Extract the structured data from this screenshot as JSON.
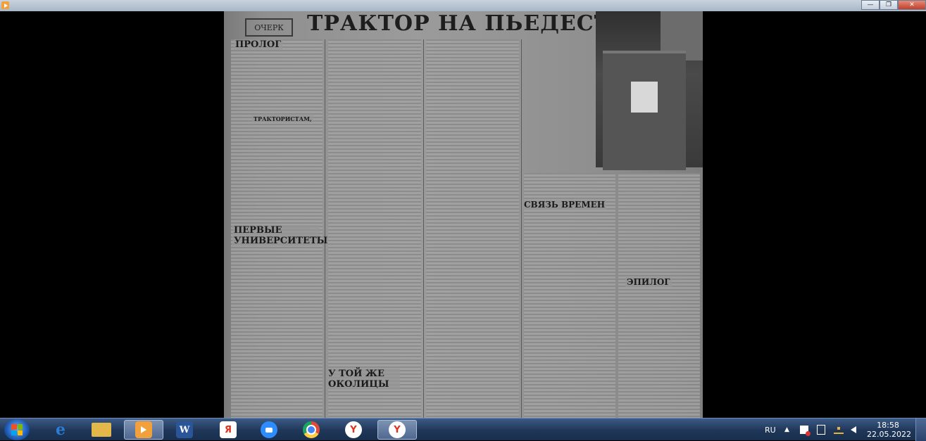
{
  "window": {
    "minimize_glyph": "—",
    "maximize_glyph": "❐",
    "close_glyph": "✕"
  },
  "newspaper": {
    "title": "ТРАКТОР НА ПЬЕДЕСТАЛЕ",
    "rubric": "ОЧЕРК",
    "headings": {
      "prologue": "ПРОЛОГ",
      "first_universities": "ПЕРВЫЕ УНИВЕРСИТЕТЫ",
      "same_outskirts": "У ТОЙ ЖЕ ОКОЛИЦЫ",
      "time_link": "СВЯЗЬ ВРЕМЕН",
      "epilogue": "ЭПИЛОГ",
      "tractor_drivers": "ТРАКТОРИСТАМ,"
    }
  },
  "taskbar": {
    "items": [
      {
        "name": "internet-explorer",
        "glyph": "e",
        "color": "#2b7cd3"
      },
      {
        "name": "file-explorer",
        "glyph": "",
        "color": "#e2b84a"
      },
      {
        "name": "media-player",
        "glyph": "",
        "color": "#f2a03b"
      },
      {
        "name": "word",
        "glyph": "W",
        "color": "#2a5699"
      },
      {
        "name": "yandex-ya",
        "glyph": "Я",
        "color": "#ffffff"
      },
      {
        "name": "zoom",
        "glyph": "",
        "color": "#2d8cff"
      },
      {
        "name": "chrome",
        "glyph": "",
        "color": "#dd4b39"
      },
      {
        "name": "yandex-browser",
        "glyph": "Y",
        "color": "#ffffff"
      },
      {
        "name": "yandex-browser-2",
        "glyph": "Y",
        "color": "#ffffff"
      }
    ],
    "language": "RU",
    "clock": {
      "time": "18:58",
      "date": "22.05.2022"
    }
  }
}
